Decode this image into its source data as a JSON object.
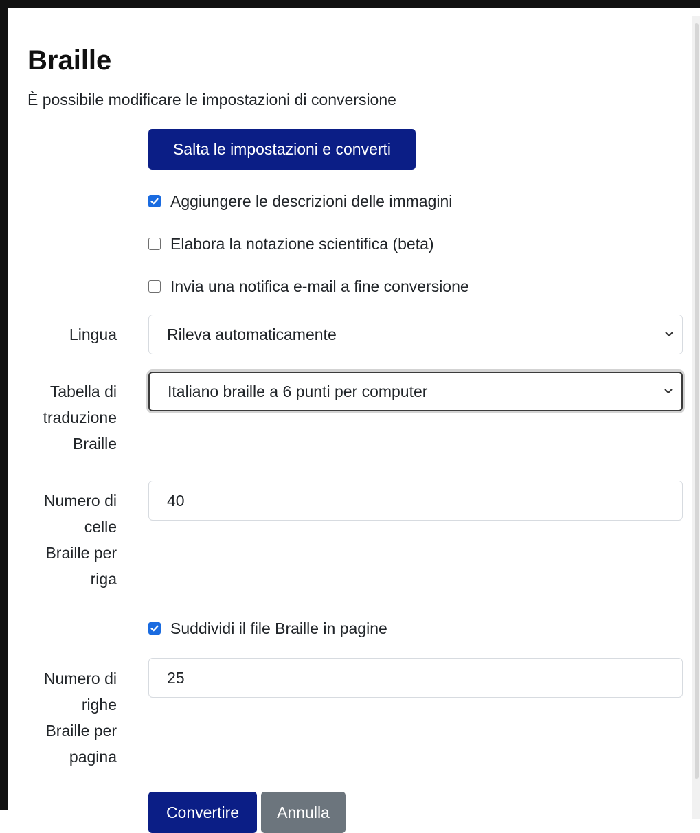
{
  "page": {
    "title": "Braille",
    "subtitle": "È possibile modificare le impostazioni di conversione"
  },
  "buttons": {
    "skip": "Salta le impostazioni e converti",
    "convert": "Convertire",
    "cancel": "Annulla"
  },
  "options": {
    "image_descriptions": {
      "label": "Aggiungere le descrizioni delle immagini",
      "checked": true
    },
    "scientific_notation": {
      "label": "Elabora la notazione scientifica (beta)",
      "checked": false
    },
    "email_notification": {
      "label": "Invia una notifica e-mail a fine conversione",
      "checked": false
    },
    "split_pages": {
      "label": "Suddividi il file Braille in pagine",
      "checked": true
    }
  },
  "fields": {
    "language": {
      "label": "Lingua",
      "value": "Rileva automaticamente"
    },
    "table": {
      "label_lines": [
        "Tabella di",
        "traduzione",
        "Braille"
      ],
      "value": "Italiano braille a 6 punti per computer"
    },
    "cells": {
      "label_lines": [
        "Numero di",
        "celle",
        "Braille per",
        "riga"
      ],
      "value": "40"
    },
    "lines": {
      "label_lines": [
        "Numero di",
        "righe",
        "Braille per",
        "pagina"
      ],
      "value": "25"
    }
  },
  "icons": {
    "checkmark": "check-icon",
    "dropdown": "chevron-down-icon"
  },
  "colors": {
    "primary": "#0b1e86",
    "secondary": "#6c757d",
    "checkbox_checked": "#1a6be0"
  }
}
